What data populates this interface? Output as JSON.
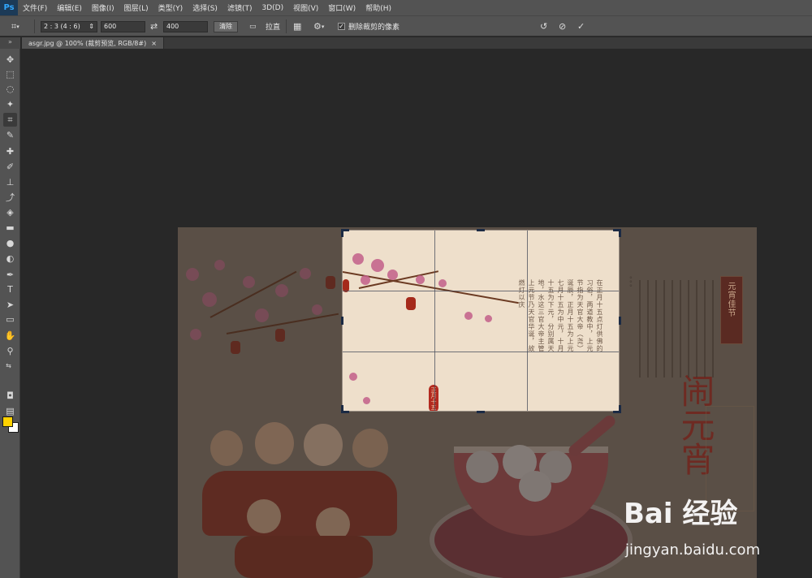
{
  "app": {
    "logo": "Ps"
  },
  "menu": [
    "文件(F)",
    "编辑(E)",
    "图像(I)",
    "图层(L)",
    "类型(Y)",
    "选择(S)",
    "滤镜(T)",
    "3D(D)",
    "视图(V)",
    "窗口(W)",
    "帮助(H)"
  ],
  "options": {
    "ratio_value": "2 : 3 (4 : 6)",
    "width_value": "600",
    "height_value": "400",
    "clear_label": "清除",
    "straighten_label": "拉直",
    "delete_cropped_label": "删除裁剪的像素",
    "delete_cropped_checked": true
  },
  "tab": {
    "title": "asgr.jpg @ 100% (裁剪预览, RGB/8#)",
    "close": "×"
  },
  "colors": {
    "foreground": "#ffd200",
    "background": "#ffffff"
  },
  "artwork": {
    "title_seal": "元宵佳节",
    "big_chars": [
      "闹",
      "元",
      "宵"
    ],
    "small_seal": "正月十五",
    "poem_columns": [
      "在正月十五点灯供佛的",
      "习俗，两道教中，上元",
      "节指为天官大帝（尧）",
      "诞辰，正月十五为上元",
      "七月十五为中元，十月",
      "十五为下元，分别属天",
      "地，水这三官大帝主管",
      "上元节乃天官华诞，故",
      "燃灯以庆"
    ]
  },
  "watermark": {
    "logo_text": "Bai 经验",
    "url": "jingyan.baidu.com"
  }
}
